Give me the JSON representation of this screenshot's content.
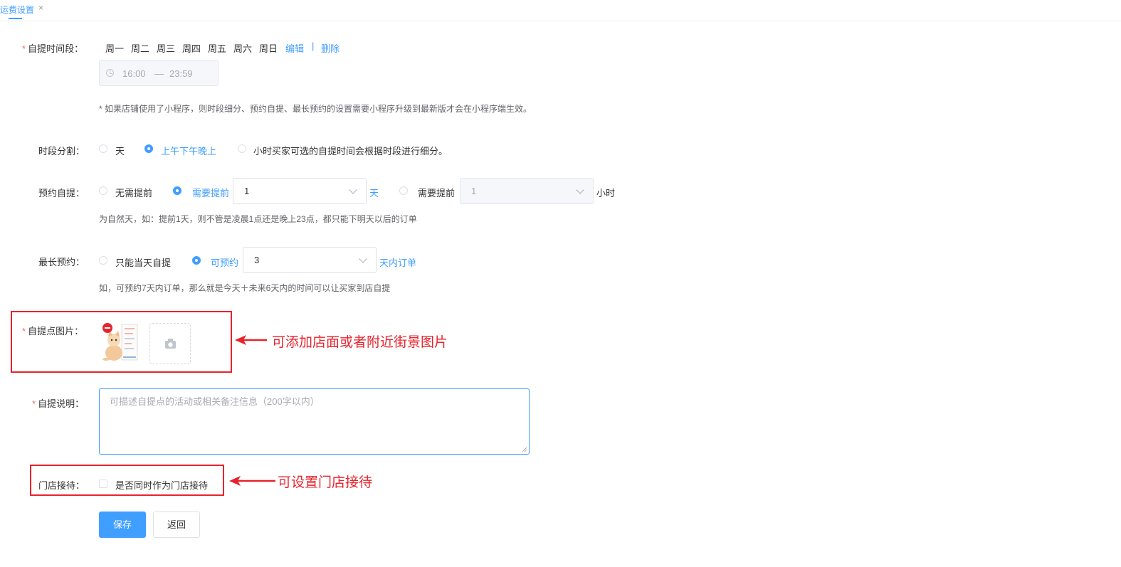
{
  "tab": {
    "title": "运费设置",
    "close": "×"
  },
  "pickup_time": {
    "required": "*",
    "label": "自提时间段：",
    "days": [
      "周一",
      "周二",
      "周三",
      "周四",
      "周五",
      "周六",
      "周日"
    ],
    "edit": "编辑",
    "separator": "|",
    "delete": "删除",
    "start": "16:00",
    "dash": "—",
    "end": "23:59",
    "note": "* 如果店铺使用了小程序，则时段细分、预约自提、最长预约的设置需要小程序升级到最新版才会在小程序端生效。"
  },
  "time_split": {
    "label": "时段分割：",
    "options": [
      "天",
      "上午下午晚上",
      "小时买家可选的自提时间会根据时段进行细分。"
    ],
    "selected_index": 1
  },
  "reserve": {
    "label": "预约自提：",
    "option_none": "无需提前",
    "option_days": "需要提前",
    "days_value": "1",
    "days_unit": "天",
    "option_hours": "需要提前",
    "hours_value": "1",
    "hours_unit": "小时",
    "hint": "为自然天，如：提前1天，则不管是凌晨1点还是晚上23点，都只能下明天以后的订单"
  },
  "max_reserve": {
    "label": "最长预约：",
    "option_today": "只能当天自提",
    "option_days": "可预约",
    "days_value": "3",
    "days_unit": "天内订单",
    "hint": "如，可预约7天内订单，那么就是今天＋未来6天内的时间可以让买家到店自提"
  },
  "pickup_image": {
    "required": "*",
    "label": "自提点图片：",
    "annotation": "可添加店面或者附近街景图片"
  },
  "pickup_desc": {
    "required": "*",
    "label": "自提说明：",
    "placeholder": "可描述自提点的活动或相关备注信息（200字以内）"
  },
  "reception": {
    "label": "门店接待：",
    "checkbox_label": "是否同时作为门店接待",
    "annotation": "可设置门店接待"
  },
  "buttons": {
    "save": "保存",
    "back": "返回"
  },
  "colors": {
    "primary": "#409eff",
    "annotation_red": "#e7232c",
    "required": "#f56c6c"
  }
}
